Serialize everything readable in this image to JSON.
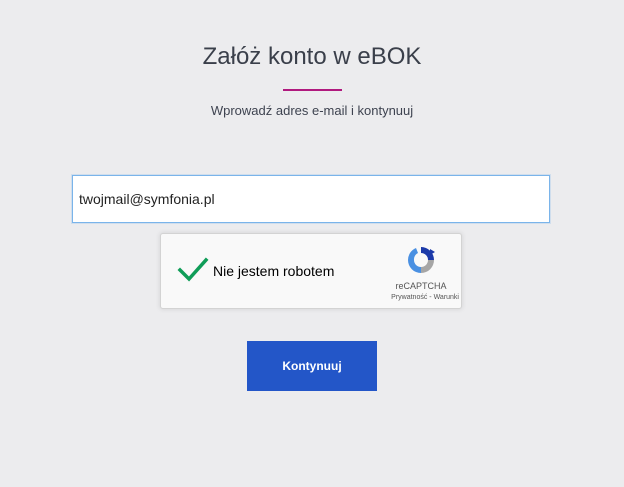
{
  "header": {
    "title": "Załóż konto w eBOK",
    "subtitle": "Wprowadź adres e-mail i kontynuuj"
  },
  "form": {
    "email_value": "twojmail@symfonia.pl"
  },
  "captcha": {
    "label": "Nie jestem robotem",
    "checked": true,
    "brand": "reCAPTCHA",
    "privacy_link": "Prywatność",
    "separator": " - ",
    "terms_link": "Warunki"
  },
  "actions": {
    "continue_label": "Kontynuuj"
  },
  "colors": {
    "background": "#ececee",
    "accent": "#b0197e",
    "button": "#2356c8",
    "check": "#0f9d58"
  },
  "icons": {
    "check": "checkmark-icon",
    "captcha_logo": "recaptcha-logo-icon"
  }
}
